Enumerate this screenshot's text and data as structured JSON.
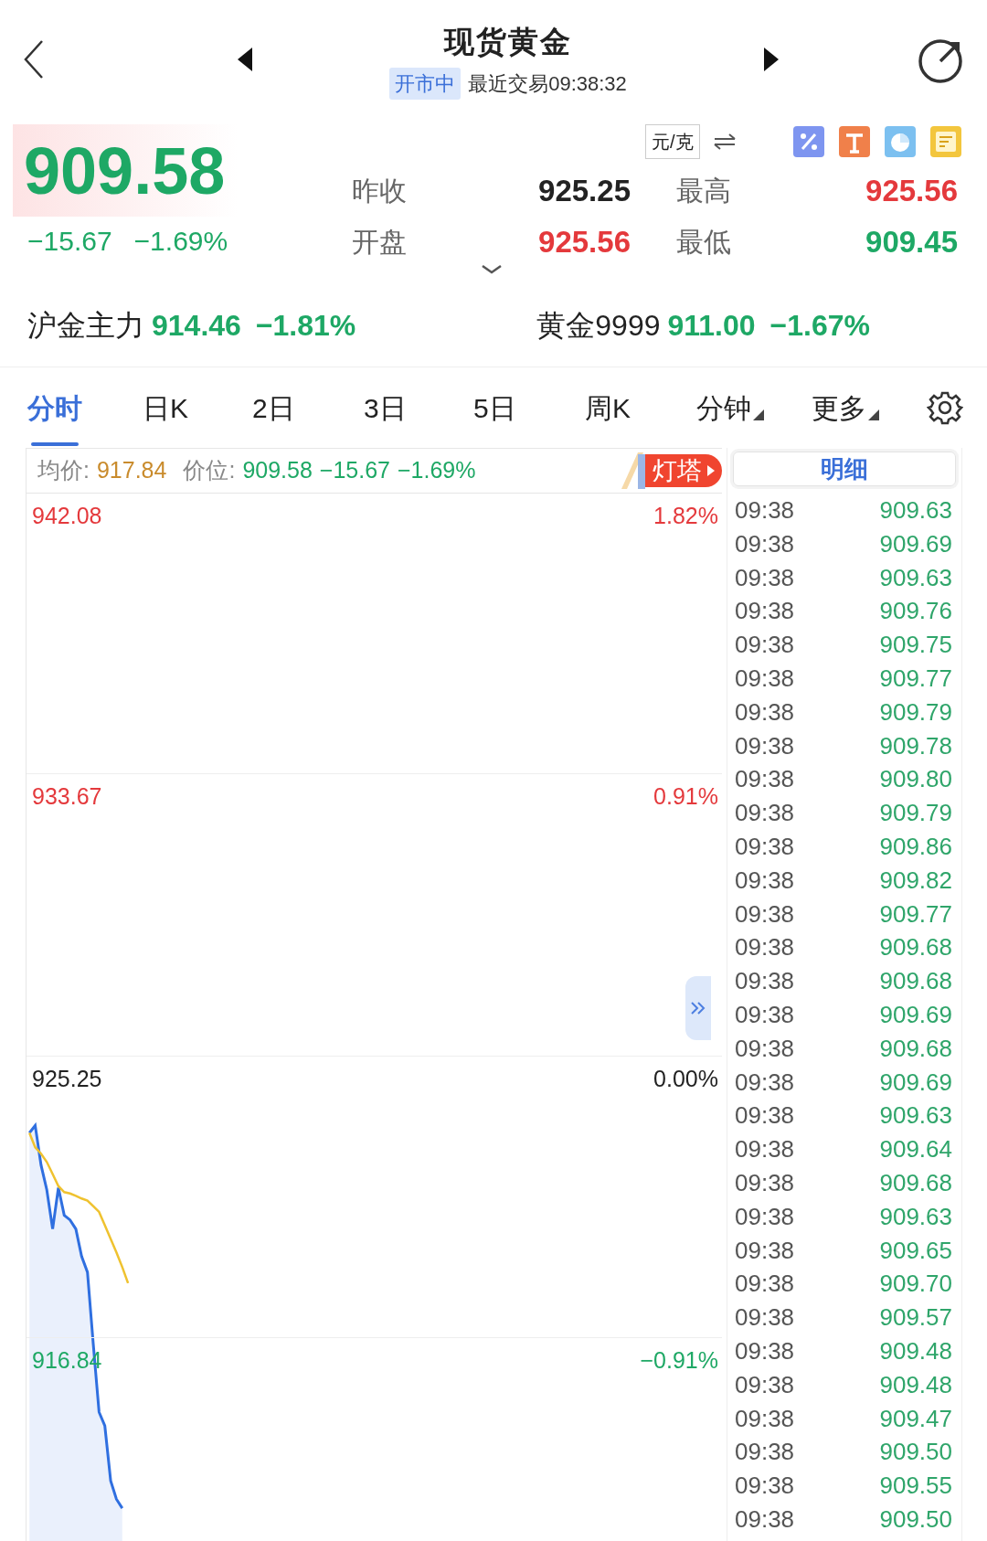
{
  "header": {
    "title": "现货黄金",
    "status_badge": "开市中",
    "last_trade": "最近交易09:38:32"
  },
  "quote": {
    "price": "909.58",
    "change": "−15.67",
    "change_pct": "−1.69%",
    "unit": "元/克",
    "stats": [
      {
        "label": "昨收",
        "value": "925.25",
        "color": "#222222"
      },
      {
        "label": "最高",
        "value": "925.56",
        "color": "#e4393c"
      },
      {
        "label": "开盘",
        "value": "925.56",
        "color": "#e4393c"
      },
      {
        "label": "最低",
        "value": "909.45",
        "color": "#1ea865"
      }
    ]
  },
  "related": [
    {
      "name": "沪金主力",
      "price": "914.46",
      "change_pct": "−1.81%"
    },
    {
      "name": "黄金9999",
      "price": "911.00",
      "change_pct": "−1.67%"
    }
  ],
  "tabs": [
    {
      "label": "分时",
      "selected": true,
      "has_menu": false
    },
    {
      "label": "日K",
      "selected": false,
      "has_menu": false
    },
    {
      "label": "2日",
      "selected": false,
      "has_menu": false
    },
    {
      "label": "3日",
      "selected": false,
      "has_menu": false
    },
    {
      "label": "5日",
      "selected": false,
      "has_menu": false
    },
    {
      "label": "周K",
      "selected": false,
      "has_menu": false
    },
    {
      "label": "分钟",
      "selected": false,
      "has_menu": true
    },
    {
      "label": "更多",
      "selected": false,
      "has_menu": true
    }
  ],
  "chart_header": {
    "avg_label": "均价:",
    "avg_value": "917.84",
    "price_label": "价位:",
    "price_value": "909.58",
    "change": "−15.67",
    "change_pct": "−1.69%",
    "badge": "灯塔"
  },
  "chart": {
    "levels": [
      {
        "pct": "1.82%",
        "color": "#e4393c"
      },
      {
        "pct": "0.91%",
        "color": "#e4393c"
      },
      {
        "pct": "0.00%",
        "color": "#222222"
      },
      {
        "pct": "−0.91%",
        "color": "#1ea865"
      }
    ],
    "chart_data": {
      "type": "line",
      "grid": true,
      "categories": [
        null,
        null,
        null,
        null,
        null,
        null,
        null,
        null,
        null,
        null,
        null,
        null,
        null,
        null,
        null,
        null,
        null,
        null,
        null,
        null,
        null,
        null,
        null,
        null,
        null,
        null,
        null,
        null,
        null,
        null,
        null,
        null,
        null,
        null,
        null,
        null,
        null,
        null,
        null,
        null,
        null,
        null,
        null,
        null,
        null,
        null,
        null,
        null,
        null,
        null,
        null,
        null,
        null,
        null,
        null,
        null,
        null,
        null,
        null,
        null,
        null,
        null,
        null,
        null,
        null,
        null,
        null,
        null,
        null,
        null,
        null,
        null,
        null,
        null,
        null,
        null,
        null,
        null,
        null,
        null,
        null,
        null,
        null,
        null,
        null,
        null,
        null,
        null,
        null,
        null,
        null,
        null,
        null,
        null,
        null,
        null,
        null,
        null,
        null,
        null,
        null,
        null,
        null,
        null,
        null,
        null,
        null,
        null,
        null,
        null,
        null,
        null,
        null,
        null,
        null,
        null,
        null,
        null,
        null,
        null
      ],
      "ylim": [
        910.75,
        943.4
      ],
      "yticks": [
        {
          "value": 916.84,
          "label": "916.84"
        },
        {
          "value": 925.25,
          "label": "925.25"
        },
        {
          "value": 933.67,
          "label": "933.67"
        },
        {
          "value": 942.08,
          "label": "942.08"
        }
      ],
      "series": [
        {
          "type": "area",
          "color": "#2f6fe0",
          "values": [
            922.94,
            923.16,
            921.98,
            921.24,
            920.07,
            921.3,
            920.48,
            920.34,
            920.07,
            919.25,
            918.78,
            916.65,
            914.6,
            914.19,
            912.55,
            912.0,
            911.73,
            null,
            null,
            null,
            null,
            null,
            null,
            null,
            null,
            null,
            null,
            null,
            null,
            null,
            null,
            null,
            null,
            null,
            null,
            null,
            null,
            null,
            null,
            null,
            null,
            null,
            null,
            null,
            null,
            null,
            null,
            null,
            null,
            null,
            null,
            null,
            null,
            null,
            null,
            null,
            null,
            null,
            null,
            null,
            null,
            null,
            null,
            null,
            null,
            null,
            null,
            null,
            null,
            null,
            null,
            null,
            null,
            null,
            null,
            null,
            null,
            null,
            null,
            null,
            null,
            null,
            null,
            null,
            null,
            null,
            null,
            null,
            null,
            null,
            null,
            null,
            null,
            null,
            null,
            null,
            null,
            null,
            null,
            null,
            null,
            null,
            null,
            null,
            null,
            null,
            null,
            null,
            null,
            null,
            null,
            null,
            null,
            null,
            null,
            null,
            null,
            null,
            null,
            null
          ]
        },
        {
          "type": "line",
          "color": "#efc22f",
          "values": [
            922.94,
            922.51,
            922.32,
            922.07,
            921.71,
            921.35,
            921.17,
            921.13,
            921.06,
            920.98,
            920.92,
            920.75,
            920.58,
            920.18,
            919.77,
            919.37,
            918.93,
            918.45,
            null,
            null,
            null,
            null,
            null,
            null,
            null,
            null,
            null,
            null,
            null,
            null,
            null,
            null,
            null,
            null,
            null,
            null,
            null,
            null,
            null,
            null,
            null,
            null,
            null,
            null,
            null,
            null,
            null,
            null,
            null,
            null,
            null,
            null,
            null,
            null,
            null,
            null,
            null,
            null,
            null,
            null,
            null,
            null,
            null,
            null,
            null,
            null,
            null,
            null,
            null,
            null,
            null,
            null,
            null,
            null,
            null,
            null,
            null,
            null,
            null,
            null,
            null,
            null,
            null,
            null,
            null,
            null,
            null,
            null,
            null,
            null,
            null,
            null,
            null,
            null,
            null,
            null,
            null,
            null,
            null,
            null,
            null,
            null,
            null,
            null,
            null,
            null,
            null,
            null,
            null,
            null,
            null,
            null,
            null,
            null,
            null,
            null,
            null,
            null,
            null,
            null
          ]
        }
      ]
    }
  },
  "detail": {
    "title": "明细",
    "rows": [
      {
        "time": "09:38",
        "price": "909.63"
      },
      {
        "time": "09:38",
        "price": "909.69"
      },
      {
        "time": "09:38",
        "price": "909.63"
      },
      {
        "time": "09:38",
        "price": "909.76"
      },
      {
        "time": "09:38",
        "price": "909.75"
      },
      {
        "time": "09:38",
        "price": "909.77"
      },
      {
        "time": "09:38",
        "price": "909.79"
      },
      {
        "time": "09:38",
        "price": "909.78"
      },
      {
        "time": "09:38",
        "price": "909.80"
      },
      {
        "time": "09:38",
        "price": "909.79"
      },
      {
        "time": "09:38",
        "price": "909.86"
      },
      {
        "time": "09:38",
        "price": "909.82"
      },
      {
        "time": "09:38",
        "price": "909.77"
      },
      {
        "time": "09:38",
        "price": "909.68"
      },
      {
        "time": "09:38",
        "price": "909.68"
      },
      {
        "time": "09:38",
        "price": "909.69"
      },
      {
        "time": "09:38",
        "price": "909.68"
      },
      {
        "time": "09:38",
        "price": "909.69"
      },
      {
        "time": "09:38",
        "price": "909.63"
      },
      {
        "time": "09:38",
        "price": "909.64"
      },
      {
        "time": "09:38",
        "price": "909.68"
      },
      {
        "time": "09:38",
        "price": "909.63"
      },
      {
        "time": "09:38",
        "price": "909.65"
      },
      {
        "time": "09:38",
        "price": "909.70"
      },
      {
        "time": "09:38",
        "price": "909.57"
      },
      {
        "time": "09:38",
        "price": "909.48"
      },
      {
        "time": "09:38",
        "price": "909.48"
      },
      {
        "time": "09:38",
        "price": "909.47"
      },
      {
        "time": "09:38",
        "price": "909.50"
      },
      {
        "time": "09:38",
        "price": "909.55"
      },
      {
        "time": "09:38",
        "price": "909.50"
      }
    ]
  }
}
